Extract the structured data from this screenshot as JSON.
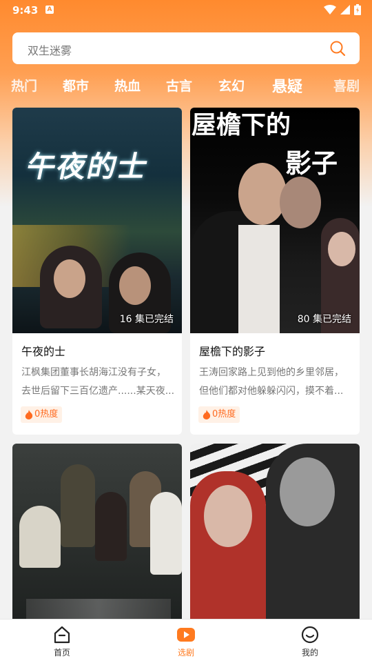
{
  "status_bar": {
    "time": "9:43",
    "notif": "A"
  },
  "search": {
    "placeholder": "双生迷雾"
  },
  "tabs": [
    {
      "label": "热门"
    },
    {
      "label": "都市"
    },
    {
      "label": "热血"
    },
    {
      "label": "古言"
    },
    {
      "label": "玄幻"
    },
    {
      "label": "悬疑",
      "active": true
    },
    {
      "label": "喜剧"
    }
  ],
  "cards": [
    {
      "title": "午夜的士",
      "poster_title": "午夜的士",
      "episodes": "16 集已完结",
      "desc_line1": "江枫集团董事长胡海江没有子女，",
      "desc_line2": "去世后留下三百亿遗产......某天夜...",
      "heat": "0热度"
    },
    {
      "title": "屋檐下的影子",
      "poster_title_1": "屋檐下的",
      "poster_title_2": "影子",
      "episodes": "80 集已完结",
      "desc_line1": "王涛回家路上见到他的乡里邻居，",
      "desc_line2": "但他们都对他躲躲闪闪，摸不着...",
      "heat": "0热度"
    },
    {
      "title": "",
      "episodes": ""
    },
    {
      "title": "",
      "episodes": ""
    }
  ],
  "bottom_nav": [
    {
      "label": "首页",
      "icon": "home-icon"
    },
    {
      "label": "选剧",
      "icon": "play-icon",
      "active": true
    },
    {
      "label": "我的",
      "icon": "profile-icon"
    }
  ],
  "colors": {
    "accent": "#ff7a1f",
    "gradient_top": "#ff8a2e"
  }
}
